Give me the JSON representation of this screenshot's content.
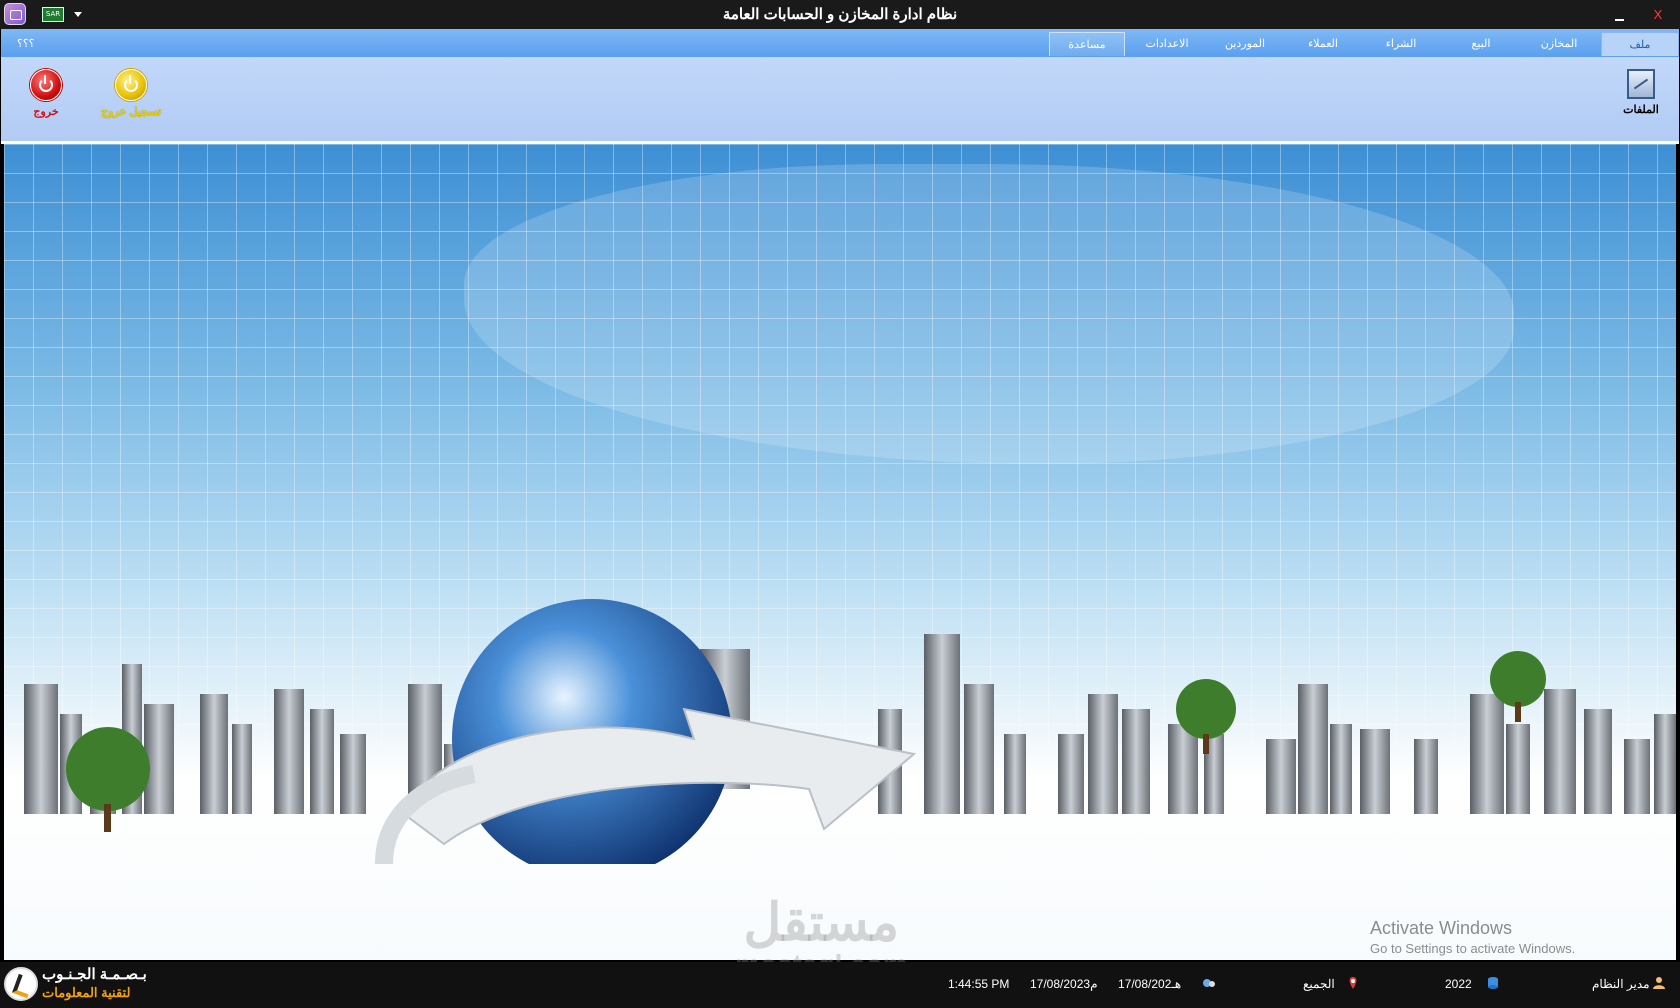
{
  "window": {
    "title": "نظام ادارة المخازن و الحسابات العامة",
    "flag_text": "SAR",
    "close_label": "X"
  },
  "ribbon": {
    "tabs": [
      {
        "label": "ملف",
        "active": true
      },
      {
        "label": "المخازن"
      },
      {
        "label": "البيع"
      },
      {
        "label": "الشراء"
      },
      {
        "label": "العملاء"
      },
      {
        "label": "الموردين"
      },
      {
        "label": "الاعدادات"
      },
      {
        "label": "مساعدة"
      }
    ],
    "help_marks": "؟؟؟",
    "buttons": {
      "files_label": "الملفات",
      "logout_label": "تسجيل خروج",
      "exit_label": "خروج"
    }
  },
  "status": {
    "user": "مدير النظام",
    "year": "2022",
    "branch": "الجميع",
    "hijri_date": "17/08/202هـ",
    "gregorian_date": "17/08/2023م",
    "time": "1:44:55 PM",
    "company_line1": "بـصـمـة الجـنـوب",
    "company_line2": "لتقنية المعلومات"
  },
  "watermarks": {
    "activate_title": "Activate Windows",
    "activate_sub": "Go to Settings to activate Windows.",
    "mostaql_ar": "مستقل",
    "mostaql_en": "mostaql.com"
  },
  "colors": {
    "ribbon_tab_bg": "#6aa9f2",
    "ribbon_body_bg": "#b8d0f7",
    "exit_red": "#d41010",
    "logout_yellow": "#e8d000",
    "brand_orange": "#f0a010"
  }
}
